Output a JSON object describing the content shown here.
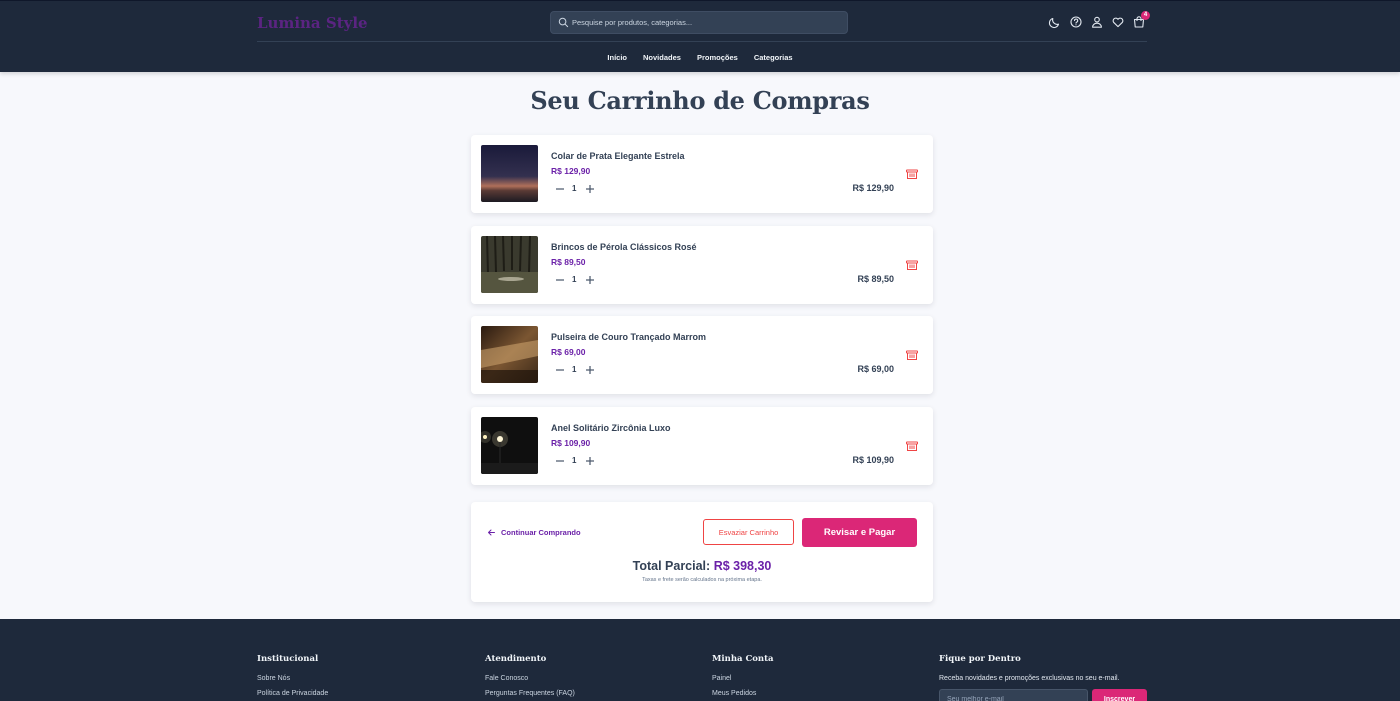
{
  "header": {
    "logo": "Lumina Style",
    "search_placeholder": "Pesquise por produtos, categorias...",
    "icons": [
      "moon-icon",
      "help-icon",
      "user-icon",
      "heart-icon",
      "shopping-bag-icon"
    ],
    "cart_count": "4",
    "nav": [
      "Início",
      "Novidades",
      "Promoções",
      "Categorias"
    ]
  },
  "page": {
    "title": "Seu Carrinho de Compras"
  },
  "cart": {
    "items": [
      {
        "name": "Colar de Prata Elegante Estrela",
        "price": "R$ 129,90",
        "qty": "1",
        "total": "R$ 129,90"
      },
      {
        "name": "Brincos de Pérola Clássicos Rosé",
        "price": "R$ 89,50",
        "qty": "1",
        "total": "R$ 89,50"
      },
      {
        "name": "Pulseira de Couro Trançado Marrom",
        "price": "R$ 69,00",
        "qty": "1",
        "total": "R$ 69,00"
      },
      {
        "name": "Anel Solitário Zircônia Luxo",
        "price": "R$ 109,90",
        "qty": "1",
        "total": "R$ 109,90"
      }
    ]
  },
  "summary": {
    "continue_label": "Continuar Comprando",
    "clear_label": "Esvaziar Carrinho",
    "checkout_label": "Revisar e Pagar",
    "subtotal_label": "Total Parcial:",
    "subtotal_value": "R$ 398,30",
    "tax_note": "Taxas e frete serão calculados na próxima etapa."
  },
  "footer": {
    "columns": [
      {
        "title": "Institucional",
        "links": [
          "Sobre Nós",
          "Política de Privacidade"
        ]
      },
      {
        "title": "Atendimento",
        "links": [
          "Fale Conosco",
          "Perguntas Frequentes (FAQ)"
        ]
      },
      {
        "title": "Minha Conta",
        "links": [
          "Painel",
          "Meus Pedidos"
        ]
      }
    ],
    "newsletter": {
      "title": "Fique por Dentro",
      "text": "Receba novidades e promoções exclusivas no seu e-mail.",
      "placeholder": "Seu melhor e-mail",
      "button": "Inscrever"
    }
  },
  "colors": {
    "header_bg": "#1e293b",
    "accent": "#db2777",
    "brand": "#6b21a8",
    "danger": "#ef4444"
  }
}
